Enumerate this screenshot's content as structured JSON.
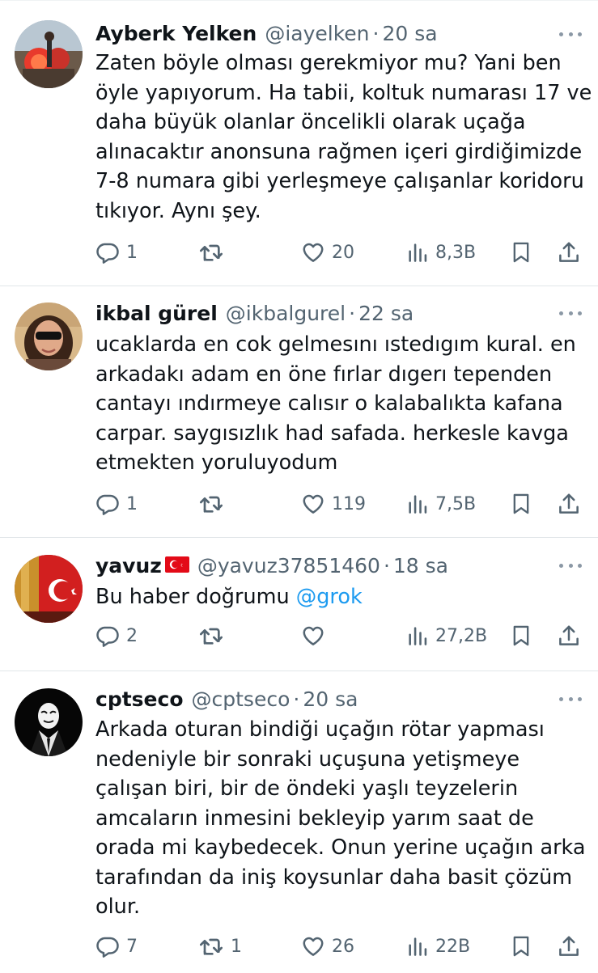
{
  "colors": {
    "text": "#0f1419",
    "secondary": "#536471",
    "link": "#1d9bf0",
    "divider": "#e1e6e9"
  },
  "tweets": [
    {
      "name": "Ayberk Yelken",
      "handle": "@iayelken",
      "separator": "·",
      "time": "20 sa",
      "avatar": "avatar-red-flare-photo",
      "lines": [
        "Zaten böyle olması gerekmiyor mu? Yani ben",
        "öyle yapıyorum. Ha tabii, koltuk numarası 17 ve",
        "daha büyük olanlar öncelikli olarak uçağa",
        "alınacaktır anonsuna rağmen içeri girdiğimizde",
        "7-8 numara gibi yerleşmeye çalışanlar koridoru",
        "tıkıyor. Aynı şey."
      ],
      "replies": "1",
      "retweets": "",
      "likes": "20",
      "views": "8,3B"
    },
    {
      "name": "ikbal gürel",
      "handle": "@ikbalgurel",
      "separator": "·",
      "time": "22 sa",
      "avatar": "avatar-woman-sunglasses-photo",
      "lines": [
        "ucaklarda en cok gelmesını ıstedıgım kural. en",
        "arkadakı adam en öne fırlar dıgerı tependen",
        "cantayı ındırmeye calısır o kalabalıkta kafana",
        "carpar. saygısızlık had safada. herkesle kavga",
        "etmekten yoruluyodum"
      ],
      "replies": "1",
      "retweets": "",
      "likes": "119",
      "views": "7,5B"
    },
    {
      "name": "yavuz",
      "handle": "@yavuz37851460",
      "separator": "·",
      "time": "18 sa",
      "avatar": "avatar-turkish-flag-photo",
      "text_prefix": "Bu haber doğrumu ",
      "mention": "@grok",
      "replies": "2",
      "retweets": "",
      "likes": "",
      "views": "27,2B"
    },
    {
      "name": "cptseco",
      "handle": "@cptseco",
      "separator": "·",
      "time": "20 sa",
      "avatar": "avatar-anonymous-mask",
      "lines": [
        "Arkada oturan bindiği uçağın rötar yapması",
        "nedeniyle bir sonraki uçuşuna yetişmeye",
        "çalışan biri, bir de öndeki yaşlı teyzelerin",
        "amcaların inmesini bekleyip yarım saat de",
        "orada mi kaybedecek. Onun yerine uçağın arka",
        "tarafından da iniş koysunlar daha basit çözüm",
        "olur."
      ],
      "replies": "7",
      "retweets": "1",
      "likes": "26",
      "views": "22B"
    }
  ]
}
